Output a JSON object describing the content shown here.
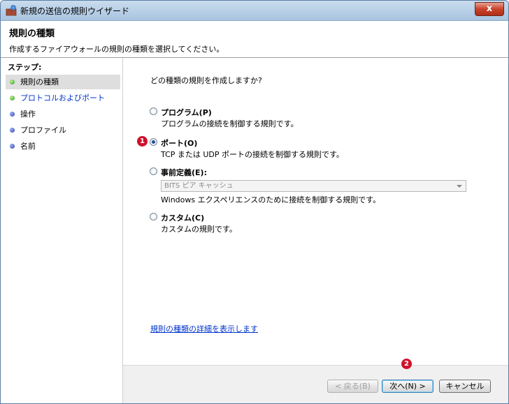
{
  "window": {
    "title": "新規の送信の規則ウイザード",
    "close_glyph": "x",
    "accent_color": "#a9c4e0"
  },
  "header": {
    "title": "規則の種類",
    "subtitle": "作成するファイアウォールの規則の種類を選択してください。"
  },
  "sidebar": {
    "heading": "ステップ:",
    "steps": [
      {
        "label": "規則の種類",
        "state": "current",
        "dot_color": "#2f9a1a"
      },
      {
        "label": "プロトコルおよびポート",
        "state": "link",
        "dot_color": "#2f9a1a"
      },
      {
        "label": "操作",
        "state": "pending",
        "dot_color": "#2a3db0"
      },
      {
        "label": "プロファイル",
        "state": "pending",
        "dot_color": "#2a3db0"
      },
      {
        "label": "名前",
        "state": "pending",
        "dot_color": "#2a3db0"
      }
    ]
  },
  "main": {
    "question": "どの種類の規則を作成しますか?",
    "options": [
      {
        "label": "プログラム(P)",
        "description": "プログラムの接続を制御する規則です。",
        "checked": false
      },
      {
        "label": "ポート(O)",
        "description": "TCP または UDP ポートの接続を制御する規則です。",
        "checked": true
      },
      {
        "label": "事前定義(E):",
        "description": "Windows エクスペリエンスのために接続を制御する規則です。",
        "checked": false
      },
      {
        "label": "カスタム(C)",
        "description": "カスタムの規則です。",
        "checked": false
      }
    ],
    "predefined_select": {
      "selected": "BITS ピア キャッシュ",
      "disabled": true
    },
    "help_link": "規則の種類の詳細を表示します"
  },
  "badges": {
    "first": "1",
    "second": "2",
    "color": "#d0102a"
  },
  "buttons": {
    "back": "< 戻る(B)",
    "next": "次へ(N) >",
    "cancel": "キャンセル"
  }
}
